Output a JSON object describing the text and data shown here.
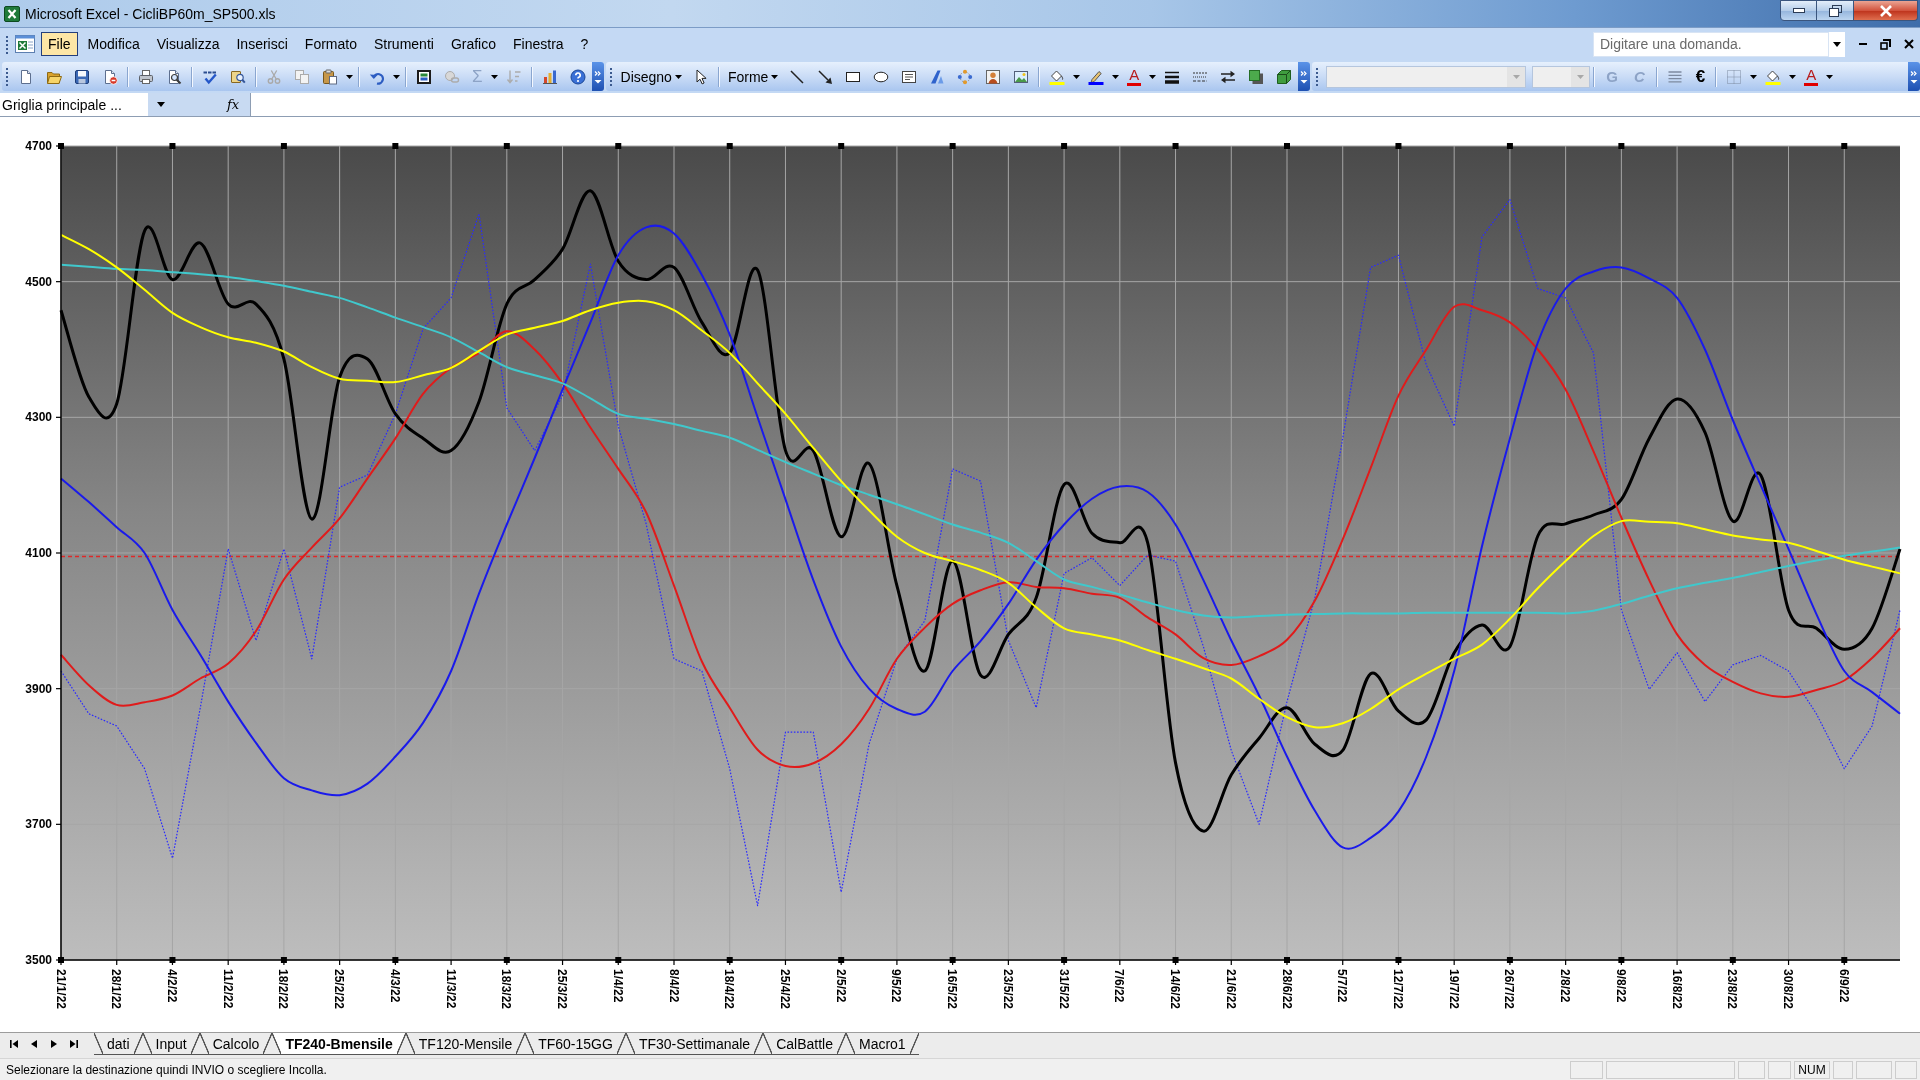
{
  "window": {
    "title": "Microsoft Excel - CicliBP60m_SP500.xls"
  },
  "menu": [
    {
      "label": "File",
      "selected": true
    },
    {
      "label": "Modifica",
      "selected": false
    },
    {
      "label": "Visualizza",
      "selected": false
    },
    {
      "label": "Inserisci",
      "selected": false
    },
    {
      "label": "Formato",
      "selected": false
    },
    {
      "label": "Strumenti",
      "selected": false
    },
    {
      "label": "Grafico",
      "selected": false
    },
    {
      "label": "Finestra",
      "selected": false
    },
    {
      "label": "?",
      "selected": false
    }
  ],
  "help_search": {
    "placeholder": "Digitare una domanda."
  },
  "toolbar": {
    "buttons": [
      {
        "kind": "sum",
        "label": "Σ",
        "disabled": true
      },
      {
        "kind": "menu",
        "label": "Disegno",
        "disabled": false
      },
      {
        "kind": "menu",
        "label": "Forme",
        "disabled": false
      },
      {
        "kind": "font_color",
        "label": "A",
        "disabled": false
      },
      {
        "kind": "bold",
        "label": "G",
        "disabled": true
      },
      {
        "kind": "italic",
        "label": "C",
        "disabled": true
      },
      {
        "kind": "plain",
        "label": "€",
        "disabled": false
      },
      {
        "kind": "font_color",
        "label": "A",
        "disabled": false
      }
    ]
  },
  "formula_bar": {
    "name_box": "Griglia principale ...",
    "function_label": "fx"
  },
  "chart": {
    "chart_data": {
      "type": "line",
      "grid": true,
      "ylim": [
        3500,
        4700
      ],
      "yticks": [
        3500,
        3700,
        3900,
        4100,
        4300,
        4500,
        4700
      ],
      "categories": [
        "21/1/22",
        null,
        "28/1/22",
        null,
        "4/2/22",
        null,
        "11/2/22",
        null,
        "18/2/22",
        null,
        "25/2/22",
        null,
        "4/3/22",
        null,
        "11/3/22",
        null,
        "18/3/22",
        null,
        "25/3/22",
        null,
        "1/4/22",
        null,
        "8/4/22",
        null,
        "18/4/22",
        null,
        "25/4/22",
        null,
        "2/5/22",
        null,
        "9/5/22",
        null,
        "16/5/22",
        null,
        "23/5/22",
        null,
        "31/5/22",
        null,
        "7/6/22",
        null,
        "14/6/22",
        null,
        "21/6/22",
        null,
        "28/6/22",
        null,
        "5/7/22",
        null,
        "12/7/22",
        null,
        "19/7/22",
        null,
        "26/7/22",
        null,
        "2/8/22",
        null,
        "9/8/22",
        null,
        "16/8/22",
        null,
        "23/8/22",
        null,
        "30/8/22",
        null,
        "6/9/22",
        null,
        null
      ],
      "series": [
        {
          "color": "#e02828",
          "line_style": "dashed",
          "values": [
            4095,
            4095,
            4095,
            4095,
            4095,
            4095,
            4095,
            4095,
            4095,
            4095,
            4095,
            4095,
            4095,
            4095,
            4095,
            4095,
            4095,
            4095,
            4095,
            4095,
            4095,
            4095,
            4095,
            4095,
            4095,
            4095,
            4095,
            4095,
            4095,
            4095,
            4095,
            4095,
            4095,
            4095,
            4095,
            4095,
            4095,
            4095,
            4095,
            4095,
            4095,
            4095,
            4095,
            4095,
            4095,
            4095,
            4095,
            4095,
            4095,
            4095,
            4095,
            4095,
            4095,
            4095,
            4095,
            4095,
            4095,
            4095,
            4095,
            4095,
            4095,
            4095,
            4095,
            4095,
            4095,
            4095,
            4095
          ]
        },
        {
          "color": "#2a2aff",
          "line_style": "dotted",
          "values": [
            3926,
            3863,
            3845,
            3782,
            3650,
            3872,
            4106,
            3971,
            4106,
            3944,
            4197,
            4215,
            4305,
            4431,
            4476,
            4600,
            4314,
            4251,
            4332,
            4526,
            4287,
            4143,
            3944,
            3926,
            3782,
            3580,
            3836,
            3836,
            3600,
            3818,
            3944,
            4000,
            4224,
            4206,
            3971,
            3872,
            4070,
            4093,
            4052,
            4097,
            4088,
            3962,
            3809,
            3700,
            3881,
            4034,
            4269,
            4521,
            4539,
            4377,
            4287,
            4566,
            4621,
            4490,
            4476,
            4395,
            4016,
            3899,
            3953,
            3881,
            3935,
            3949,
            3926,
            3863,
            3782,
            3845,
            4016
          ]
        },
        {
          "color": "#000000",
          "line_style": "solid",
          "values": [
            4458,
            4330,
            4320,
            4575,
            4503,
            4557,
            4467,
            4467,
            4386,
            4150,
            4359,
            4386,
            4305,
            4269,
            4251,
            4323,
            4467,
            4503,
            4548,
            4634,
            4530,
            4503,
            4521,
            4440,
            4395,
            4517,
            4251,
            4251,
            4124,
            4232,
            4052,
            3926,
            4088,
            3920,
            3980,
            4034,
            4201,
            4129,
            4115,
            4115,
            3791,
            3690,
            3773,
            3827,
            3872,
            3818,
            3809,
            3922,
            3867,
            3854,
            3953,
            3994,
            3962,
            4125,
            4143,
            4156,
            4179,
            4269,
            4327,
            4278,
            4147,
            4215,
            4016,
            3989,
            3958,
            3989,
            4106
          ]
        },
        {
          "color": "#e01b1b",
          "line_style": "solid",
          "values": [
            3950,
            3905,
            3876,
            3880,
            3890,
            3915,
            3937,
            3985,
            4061,
            4108,
            4151,
            4210,
            4269,
            4335,
            4373,
            4395,
            4427,
            4400,
            4350,
            4285,
            4224,
            4160,
            4052,
            3940,
            3872,
            3810,
            3786,
            3790,
            3818,
            3870,
            3944,
            3990,
            4025,
            4045,
            4057,
            4050,
            4048,
            4040,
            4034,
            4005,
            3980,
            3945,
            3935,
            3948,
            3972,
            4030,
            4120,
            4225,
            4332,
            4400,
            4463,
            4458,
            4440,
            4400,
            4341,
            4250,
            4152,
            4060,
            3980,
            3935,
            3910,
            3893,
            3888,
            3898,
            3912,
            3945,
            3989
          ]
        },
        {
          "color": "#1a1aeb",
          "line_style": "solid",
          "values": [
            4210,
            4175,
            4138,
            4100,
            4016,
            3950,
            3881,
            3820,
            3768,
            3750,
            3743,
            3760,
            3800,
            3850,
            3926,
            4040,
            4142,
            4240,
            4341,
            4440,
            4539,
            4580,
            4571,
            4510,
            4422,
            4300,
            4179,
            4060,
            3962,
            3900,
            3870,
            3866,
            3926,
            3970,
            4025,
            4090,
            4142,
            4180,
            4198,
            4190,
            4142,
            4060,
            3971,
            3890,
            3800,
            3720,
            3666,
            3680,
            3719,
            3800,
            3926,
            4110,
            4269,
            4410,
            4490,
            4515,
            4521,
            4505,
            4476,
            4400,
            4296,
            4200,
            4106,
            4010,
            3926,
            3895,
            3863
          ]
        },
        {
          "color": "#40c8cc",
          "line_style": "solid",
          "values": [
            4525,
            4522,
            4519,
            4517,
            4514,
            4511,
            4507,
            4501,
            4494,
            4485,
            4476,
            4462,
            4447,
            4433,
            4418,
            4396,
            4374,
            4362,
            4350,
            4328,
            4305,
            4298,
            4290,
            4280,
            4270,
            4252,
            4234,
            4217,
            4200,
            4186,
            4172,
            4157,
            4142,
            4130,
            4115,
            4088,
            4061,
            4050,
            4039,
            4027,
            4016,
            4008,
            4005,
            4007,
            4009,
            4010,
            4011,
            4011,
            4011,
            4012,
            4012,
            4012,
            4012,
            4012,
            4011,
            4015,
            4025,
            4037,
            4048,
            4056,
            4063,
            4072,
            4081,
            4089,
            4096,
            4102,
            4108
          ]
        },
        {
          "color": "#ffff00",
          "line_style": "solid",
          "values": [
            4569,
            4548,
            4521,
            4488,
            4454,
            4433,
            4418,
            4410,
            4397,
            4374,
            4357,
            4354,
            4352,
            4362,
            4373,
            4398,
            4422,
            4432,
            4442,
            4458,
            4469,
            4471,
            4458,
            4428,
            4395,
            4350,
            4305,
            4255,
            4206,
            4163,
            4124,
            4100,
            4088,
            4075,
            4056,
            4020,
            3989,
            3980,
            3971,
            3957,
            3944,
            3930,
            3915,
            3885,
            3858,
            3843,
            3849,
            3870,
            3899,
            3922,
            3944,
            3965,
            4003,
            4048,
            4088,
            4125,
            4147,
            4146,
            4144,
            4135,
            4126,
            4120,
            4115,
            4103,
            4090,
            4080,
            4070
          ]
        }
      ]
    }
  },
  "sheet_tabs": [
    {
      "label": "dati",
      "selected": false
    },
    {
      "label": "Input",
      "selected": false
    },
    {
      "label": "Calcolo",
      "selected": false
    },
    {
      "label": "TF240-Bmensile",
      "selected": true
    },
    {
      "label": "TF120-Mensile",
      "selected": false
    },
    {
      "label": "TF60-15GG",
      "selected": false
    },
    {
      "label": "TF30-Settimanale",
      "selected": false
    },
    {
      "label": "CalBattle",
      "selected": false
    },
    {
      "label": "Macro1",
      "selected": false
    }
  ],
  "status_bar": {
    "message": "Selezionare la destinazione quindi INVIO o scegliere Incolla.",
    "indicators": [
      "NUM"
    ]
  }
}
